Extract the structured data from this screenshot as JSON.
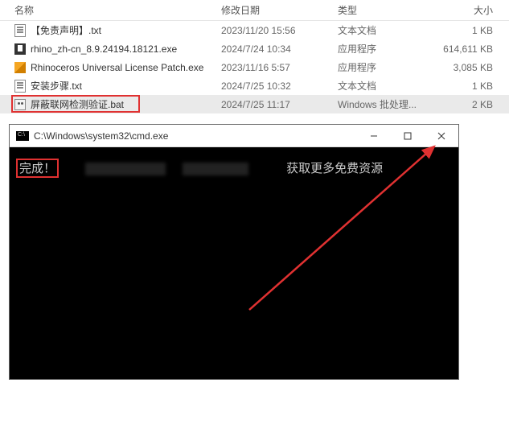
{
  "header": {
    "name": "名称",
    "date": "修改日期",
    "type": "类型",
    "size": "大小"
  },
  "files": [
    {
      "name": "【免责声明】.txt",
      "date": "2023/11/20 15:56",
      "type": "文本文档",
      "size": "1 KB",
      "icon": "txt"
    },
    {
      "name": "rhino_zh-cn_8.9.24194.18121.exe",
      "date": "2024/7/24 10:34",
      "type": "应用程序",
      "size": "614,611 KB",
      "icon": "exe"
    },
    {
      "name": "Rhinoceros Universal License Patch.exe",
      "date": "2023/11/16 5:57",
      "type": "应用程序",
      "size": "3,085 KB",
      "icon": "patch"
    },
    {
      "name": "安装步骤.txt",
      "date": "2024/7/25 10:32",
      "type": "文本文档",
      "size": "1 KB",
      "icon": "txt"
    },
    {
      "name": "屏蔽联网检测验证.bat",
      "date": "2024/7/25 11:17",
      "type": "Windows 批处理...",
      "size": "2 KB",
      "icon": "bat",
      "highlighted": true
    }
  ],
  "cmd": {
    "title": "C:\\Windows\\system32\\cmd.exe",
    "done": "完成！",
    "msg": "获取更多免费资源"
  },
  "colors": {
    "highlight": "#e03131"
  }
}
